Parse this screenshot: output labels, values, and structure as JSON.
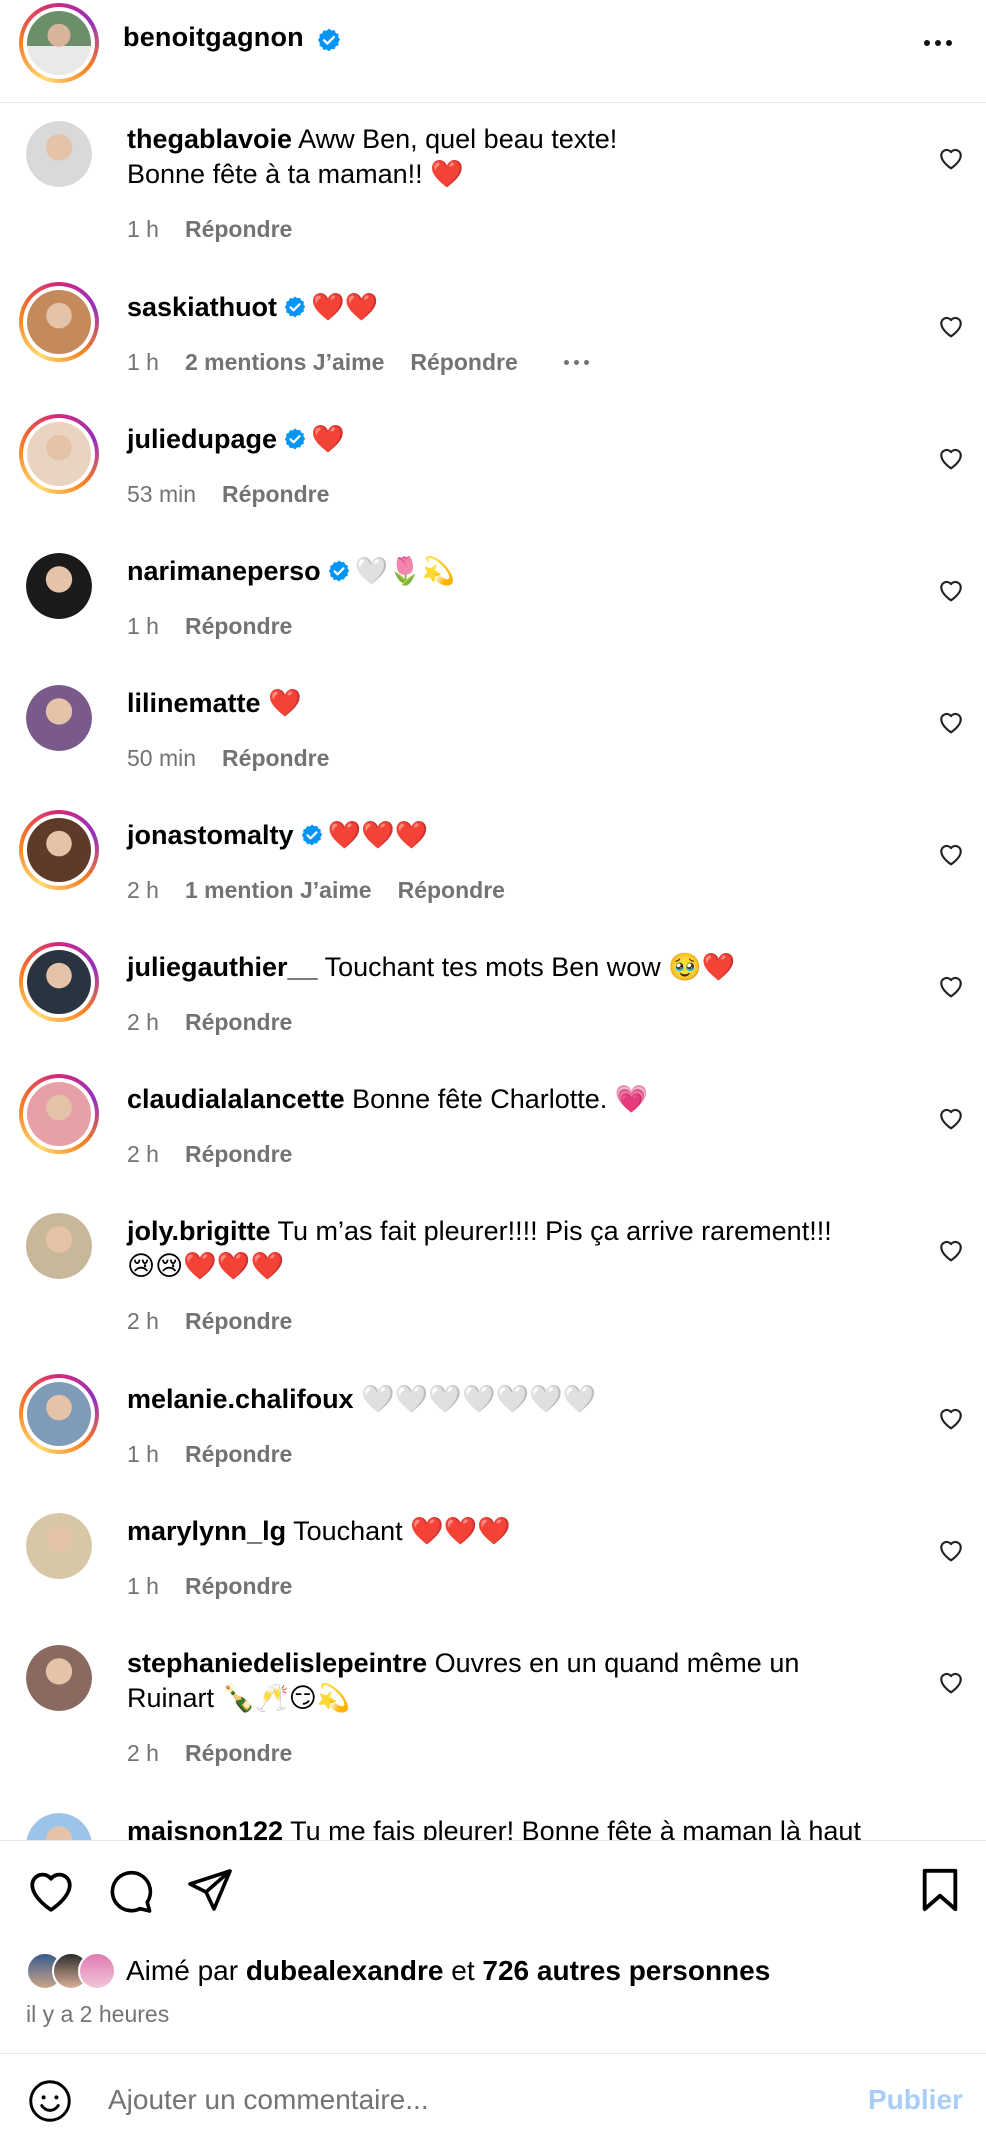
{
  "header": {
    "username": "benoitgagnon",
    "verified_icon": "verified-badge-icon",
    "more_icon": "more-horizontal-icon"
  },
  "comments": [
    {
      "user": "thegablavoie",
      "verified": false,
      "text": "Aww Ben, quel beau texte!",
      "text2": "Bonne fête à ta maman!! ❤️",
      "time": "1 h",
      "likes": "",
      "reply": "Répondre",
      "more": false,
      "ring": false,
      "color": "#d9d9d9"
    },
    {
      "user": "saskiathuot",
      "verified": true,
      "text": "❤️❤️",
      "text2": "",
      "time": "1 h",
      "likes": "2 mentions J’aime",
      "reply": "Répondre",
      "more": true,
      "ring": true,
      "color": "#c48a5c"
    },
    {
      "user": "juliedupage",
      "verified": true,
      "text": "❤️",
      "text2": "",
      "time": "53 min",
      "likes": "",
      "reply": "Répondre",
      "more": false,
      "ring": true,
      "color": "#e9d4c2"
    },
    {
      "user": "narimaneperso",
      "verified": true,
      "text": "🤍🌷💫",
      "text2": "",
      "time": "1 h",
      "likes": "",
      "reply": "Répondre",
      "more": false,
      "ring": false,
      "color": "#1a1a1a"
    },
    {
      "user": "lilinematte",
      "verified": false,
      "text": "❤️",
      "text2": "",
      "time": "50 min",
      "likes": "",
      "reply": "Répondre",
      "more": false,
      "ring": false,
      "color": "#7a5a8a"
    },
    {
      "user": "jonastomalty",
      "verified": true,
      "text": "❤️❤️❤️",
      "text2": "",
      "time": "2 h",
      "likes": "1 mention J’aime",
      "reply": "Répondre",
      "more": false,
      "ring": true,
      "color": "#5d3a2a"
    },
    {
      "user": "juliegauthier__",
      "verified": false,
      "text": "Touchant tes mots Ben wow 🥹❤️",
      "text2": "",
      "time": "2 h",
      "likes": "",
      "reply": "Répondre",
      "more": false,
      "ring": true,
      "color": "#2a3340"
    },
    {
      "user": "claudialalancette",
      "verified": false,
      "text": "Bonne fête Charlotte. 💗",
      "text2": "",
      "time": "2 h",
      "likes": "",
      "reply": "Répondre",
      "more": false,
      "ring": true,
      "color": "#e8a0a8"
    },
    {
      "user": "joly.brigitte",
      "verified": false,
      "text": "Tu m’as fait pleurer!!!! Pis ça arrive rarement!!!",
      "text2": "😢😢❤️❤️❤️",
      "time": "2 h",
      "likes": "",
      "reply": "Répondre",
      "more": false,
      "ring": false,
      "color": "#c9b79a"
    },
    {
      "user": "melanie.chalifoux",
      "verified": false,
      "text": "🤍🤍🤍🤍🤍🤍🤍",
      "text2": "",
      "time": "1 h",
      "likes": "",
      "reply": "Répondre",
      "more": false,
      "ring": true,
      "color": "#7f9bb8"
    },
    {
      "user": "marylynn_lg",
      "verified": false,
      "text": "Touchant ❤️❤️❤️",
      "text2": "",
      "time": "1 h",
      "likes": "",
      "reply": "Répondre",
      "more": false,
      "ring": false,
      "color": "#d8c7a6"
    },
    {
      "user": "stephaniedelislepeintre",
      "verified": false,
      "text": "Ouvres en un quand même un",
      "text2": "Ruinart 🍾🥂😏💫",
      "time": "2 h",
      "likes": "",
      "reply": "Répondre",
      "more": false,
      "ring": false,
      "color": "#8a6a60"
    },
    {
      "user": "maisnon122",
      "verified": false,
      "text": "Tu me fais pleurer! Bonne fête à maman là haut",
      "text2": "",
      "time": "",
      "likes": "",
      "reply": "",
      "more": false,
      "ring": false,
      "color": "#9cc4e8"
    }
  ],
  "actions": {
    "like_icon": "heart-icon",
    "comment_icon": "comment-icon",
    "share_icon": "send-icon",
    "save_icon": "bookmark-icon",
    "liked_prefix": "Aimé par",
    "liked_user": "dubealexandre",
    "liked_and": "et",
    "liked_others": "726 autres personnes",
    "time_ago": "il y a 2 heures",
    "add_comment_placeholder": "Ajouter un commentaire...",
    "publish_label": "Publier",
    "emoji_icon": "smiley-icon"
  },
  "colors": {
    "accent_blue": "#0095f6",
    "publish_disabled": "#a9cdf7",
    "meta_gray": "#737373"
  }
}
